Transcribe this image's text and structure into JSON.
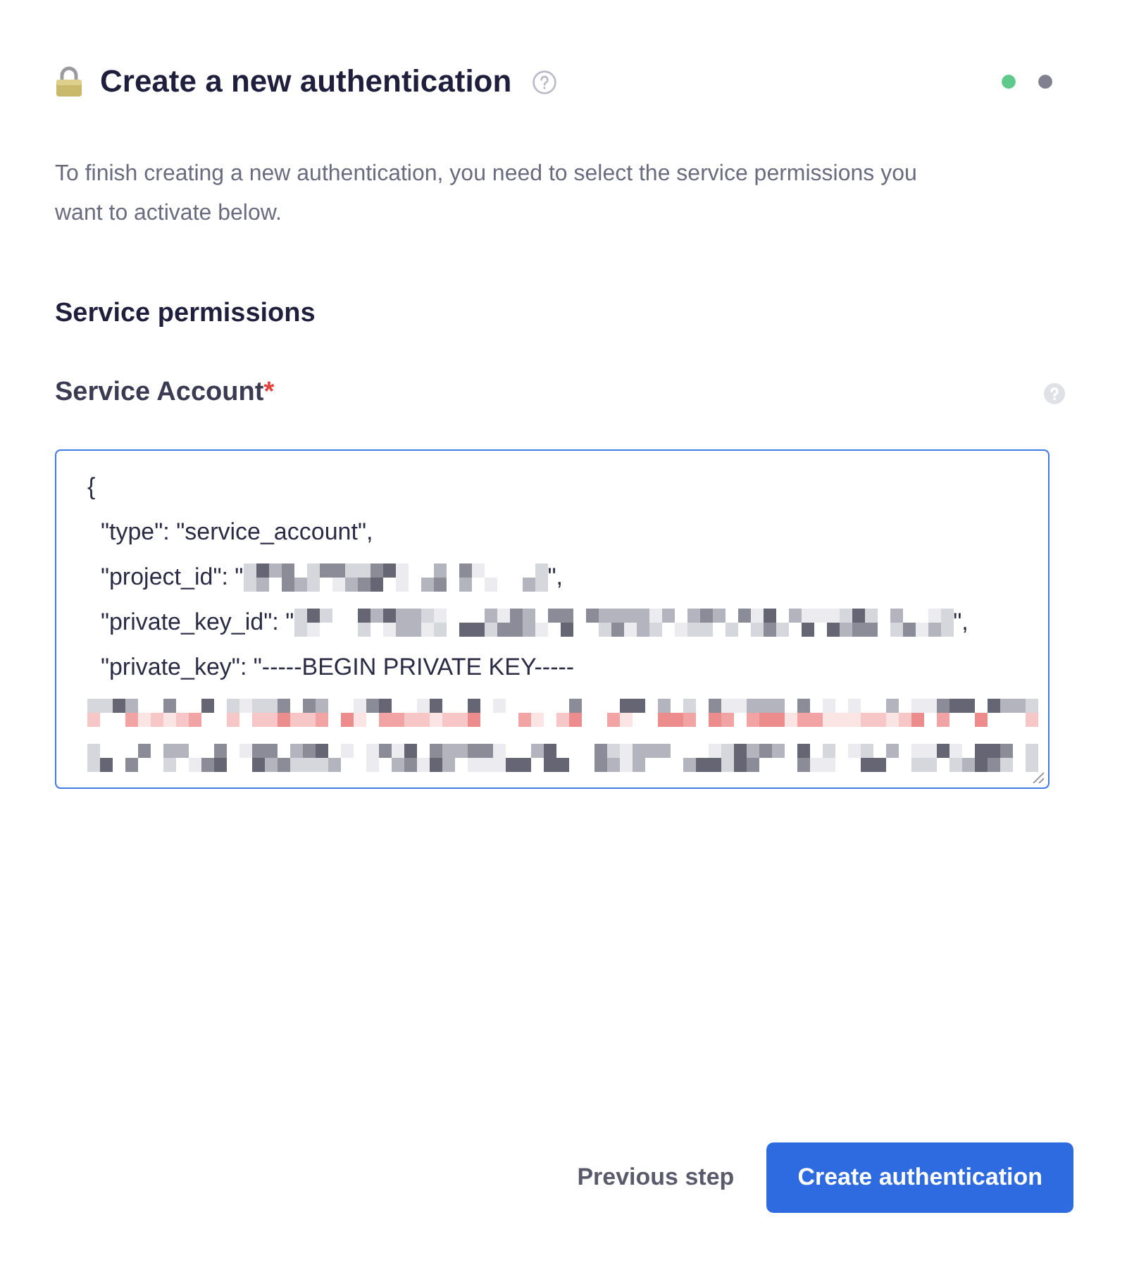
{
  "dialog": {
    "title": "Create a new authentication",
    "steps": [
      {
        "color": "#5ec98b"
      },
      {
        "color": "#80808f"
      }
    ]
  },
  "description": "To finish creating a new authentication, you need to select the service permissions you want to activate below.",
  "section_title": "Service permissions",
  "field": {
    "label": "Service Account",
    "required_mark": "*",
    "lines": [
      {
        "segments": [
          {
            "kind": "text",
            "text": "{"
          }
        ]
      },
      {
        "segments": [
          {
            "kind": "text",
            "text": "  \"type\": \"service_account\","
          }
        ]
      },
      {
        "segments": [
          {
            "kind": "text",
            "text": "  \"project_id\": \""
          },
          {
            "kind": "redacted"
          },
          {
            "kind": "text",
            "text": "\","
          }
        ]
      },
      {
        "segments": [
          {
            "kind": "text",
            "text": "  \"private_key_id\": \""
          },
          {
            "kind": "redacted"
          },
          {
            "kind": "text",
            "text": "\","
          }
        ]
      },
      {
        "segments": [
          {
            "kind": "text",
            "text": "  \"private_key\": \"-----BEGIN PRIVATE KEY-----"
          }
        ]
      },
      {
        "segments": [
          {
            "kind": "redacted"
          }
        ]
      },
      {
        "segments": [
          {
            "kind": "redacted"
          }
        ]
      }
    ]
  },
  "buttons": [
    {
      "label": "Previous step",
      "kind": "secondary"
    },
    {
      "label": "Create authentication",
      "kind": "primary"
    }
  ]
}
